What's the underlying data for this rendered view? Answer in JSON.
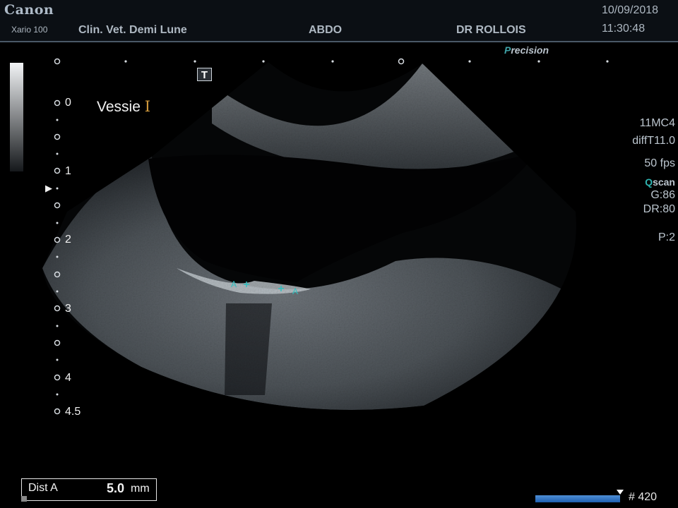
{
  "header": {
    "brand": "Canon",
    "model": "Xario 100",
    "clinic": "Clin. Vet. Demi Lune",
    "exam": "ABDO",
    "doctor": "DR ROLLOIS",
    "date": "10/09/2018",
    "time": "11:30:48"
  },
  "mode_label": {
    "prefix": "P",
    "rest": "recision"
  },
  "organ_annotation": {
    "text": "Vessie",
    "icon": "text-cursor-icon",
    "icon_glyph": "I"
  },
  "depth_scale": [
    "0",
    "1",
    "2",
    "3",
    "4",
    "4.5"
  ],
  "tool_icon": "T",
  "right_panel": {
    "probe": "11MC4",
    "preset": "diffT11.0",
    "fps": "50 fps",
    "qscan_q": "Q",
    "qscan_rest": "scan",
    "gain": "G:86",
    "dynamic_range": "DR:80",
    "power": "P:2"
  },
  "calipers": {
    "start_label": "A",
    "end_label": "A"
  },
  "measurement": {
    "label": "Dist A",
    "value": "5.0",
    "unit": "mm"
  },
  "cine": {
    "frame": "# 420"
  },
  "colors": {
    "caliper": "#2fc0c0",
    "organ_icon": "#d39a3c",
    "cine_bar": "#3a7cc8"
  }
}
